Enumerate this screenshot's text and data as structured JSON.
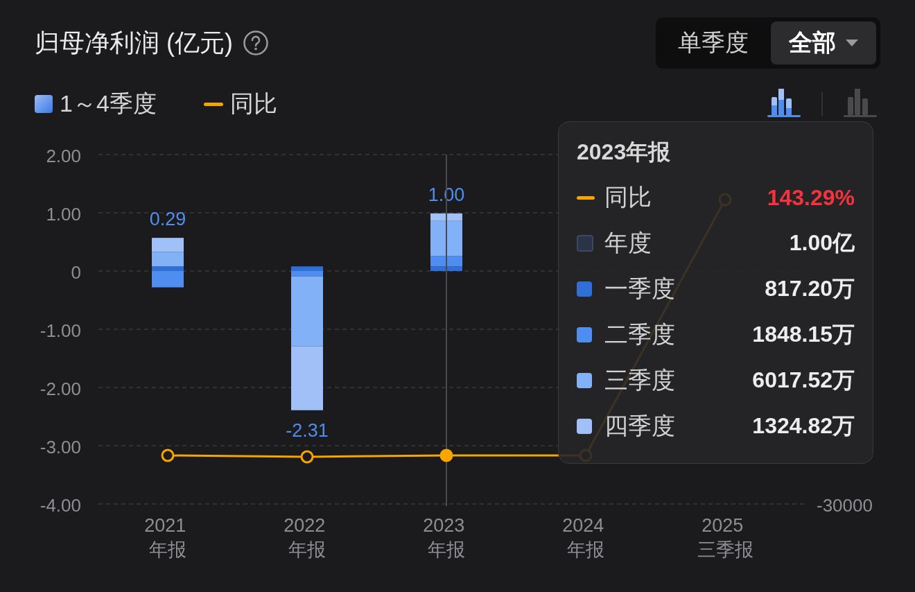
{
  "header": {
    "title": "归母净利润 (亿元)"
  },
  "view_toggle": [
    {
      "label": "单季度",
      "selected": false
    },
    {
      "label": "全部",
      "selected": true
    }
  ],
  "legend": [
    {
      "kind": "bar",
      "label": "1～4季度"
    },
    {
      "kind": "line",
      "color": "#f7a600",
      "label": "同比"
    }
  ],
  "chart_types": [
    {
      "kind": "stacked",
      "selected": true
    },
    {
      "kind": "plain",
      "selected": false
    }
  ],
  "chart": {
    "chart_data": {
      "type": "bar",
      "stacked": true,
      "grid": true,
      "categories": [
        "2021 年报",
        "2022 年报",
        "2023 年报",
        "2024 年报",
        "2025 三季报"
      ],
      "series": [
        {
          "color": "#2f6fd6",
          "values": [
            0.08,
            0.08,
            0.08,
            null,
            null
          ]
        },
        {
          "color": "#4f8ef0",
          "values": [
            -0.28,
            -0.09,
            0.18,
            null,
            null
          ]
        },
        {
          "color": "#82b1f8",
          "values": [
            0.25,
            -1.2,
            0.6,
            null,
            null
          ]
        },
        {
          "color": "#a1c0f8",
          "values": [
            0.24,
            -1.1,
            0.13,
            null,
            null
          ]
        }
      ],
      "ylim": [
        -4,
        2
      ],
      "yticks": [
        {
          "value": 2,
          "label": "2.00"
        },
        {
          "value": 1,
          "label": "1.00"
        },
        {
          "value": 0,
          "label": "0"
        },
        {
          "value": -1,
          "label": "-1.00"
        },
        {
          "value": -2,
          "label": "-2.00"
        },
        {
          "value": -3,
          "label": "-3.00"
        },
        {
          "value": -4,
          "label": "-4.00"
        }
      ],
      "value_labels": [
        "0.29",
        "-2.31",
        "1.00"
      ]
    },
    "columns": [
      {
        "hovered": false
      },
      {
        "hovered": false
      },
      {
        "hovered": true
      },
      {
        "hovered": false
      },
      {
        "hovered": false
      }
    ],
    "yoy_line": {
      "color": "#f7a600"
    },
    "right_axis_labels": [
      "-30000"
    ],
    "tooltip": {
      "title": "2023年报",
      "rows": [
        {
          "kind": "line",
          "color": "#f7a600",
          "label": "同比",
          "value": "143.29%",
          "highlight": true
        },
        {
          "kind": "outline",
          "color": "#2a3446",
          "label": "年度",
          "value": "1.00亿",
          "highlight": false
        },
        {
          "kind": "swatch",
          "color": "#2f6fd6",
          "label": "一季度",
          "value": "817.20万",
          "highlight": false
        },
        {
          "kind": "swatch",
          "color": "#4f8ef0",
          "label": "二季度",
          "value": "1848.15万",
          "highlight": false
        },
        {
          "kind": "swatch",
          "color": "#82b1f8",
          "label": "三季度",
          "value": "6017.52万",
          "highlight": false
        },
        {
          "kind": "swatch",
          "color": "#a1c0f8",
          "label": "四季度",
          "value": "1324.82万",
          "highlight": false
        }
      ]
    }
  }
}
